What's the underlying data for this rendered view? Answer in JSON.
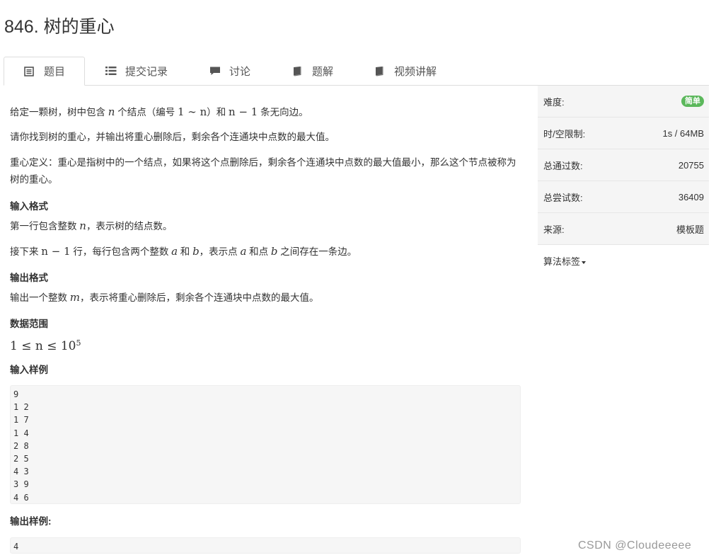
{
  "problem": {
    "title": "846. 树的重心"
  },
  "tabs": [
    {
      "label": "题目",
      "icon": "document-icon"
    },
    {
      "label": "提交记录",
      "icon": "list-icon"
    },
    {
      "label": "讨论",
      "icon": "comment-icon"
    },
    {
      "label": "题解",
      "icon": "book-icon"
    },
    {
      "label": "视频讲解",
      "icon": "book-icon"
    }
  ],
  "description": {
    "p1_a": "给定一颗树，树中包含 ",
    "p1_n": "n",
    "p1_b": " 个结点（编号 ",
    "p1_range": "1 ∼ n",
    "p1_c": "）和 ",
    "p1_edges": "n − 1",
    "p1_d": " 条无向边。",
    "p2": "请你找到树的重心，并输出将重心删除后，剩余各个连通块中点数的最大值。",
    "p3": "重心定义：重心是指树中的一个结点，如果将这个点删除后，剩余各个连通块中点数的最大值最小，那么这个节点被称为树的重心。"
  },
  "input_format": {
    "heading": "输入格式",
    "l1_a": "第一行包含整数 ",
    "l1_n": "n",
    "l1_b": "，表示树的结点数。",
    "l2_a": "接下来 ",
    "l2_n": "n − 1",
    "l2_b": " 行，每行包含两个整数 ",
    "l2_a_var": "a",
    "l2_c": " 和 ",
    "l2_b_var": "b",
    "l2_d": "，表示点 ",
    "l2_a_var2": "a",
    "l2_e": " 和点 ",
    "l2_b_var2": "b",
    "l2_f": " 之间存在一条边。"
  },
  "output_format": {
    "heading": "输出格式",
    "l1_a": "输出一个整数 ",
    "l1_m": "m",
    "l1_b": "，表示将重心删除后，剩余各个连通块中点数的最大值。"
  },
  "data_range": {
    "heading": "数据范围",
    "expr": "1 ≤ n ≤ 10",
    "exp": "5"
  },
  "sample_input": {
    "heading": "输入样例",
    "lines": [
      "9",
      "1 2",
      "1 7",
      "1 4",
      "2 8",
      "2 5",
      "4 3",
      "3 9",
      "4 6"
    ]
  },
  "sample_output": {
    "heading": "输出样例:",
    "lines": [
      "4"
    ]
  },
  "sidebar": {
    "difficulty_label": "难度:",
    "difficulty_value": "简单",
    "limit_label": "时/空限制:",
    "limit_value": "1s / 64MB",
    "passed_label": "总通过数:",
    "passed_value": "20755",
    "tried_label": "总尝试数:",
    "tried_value": "36409",
    "source_label": "来源:",
    "source_value": "模板题",
    "tags_label": "算法标签"
  },
  "watermark": "CSDN @Cloudeeeee",
  "colors": {
    "badge": "#5cb85c",
    "code_bg": "#f6f6f6",
    "side_bg": "#f5f5f5"
  }
}
